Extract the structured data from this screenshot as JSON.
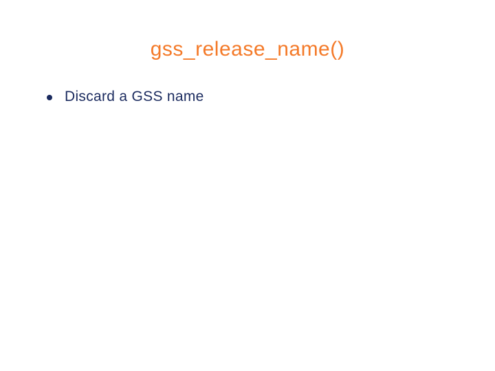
{
  "title": "gss_release_name()",
  "bullets": [
    {
      "text": "Discard a GSS name"
    }
  ]
}
